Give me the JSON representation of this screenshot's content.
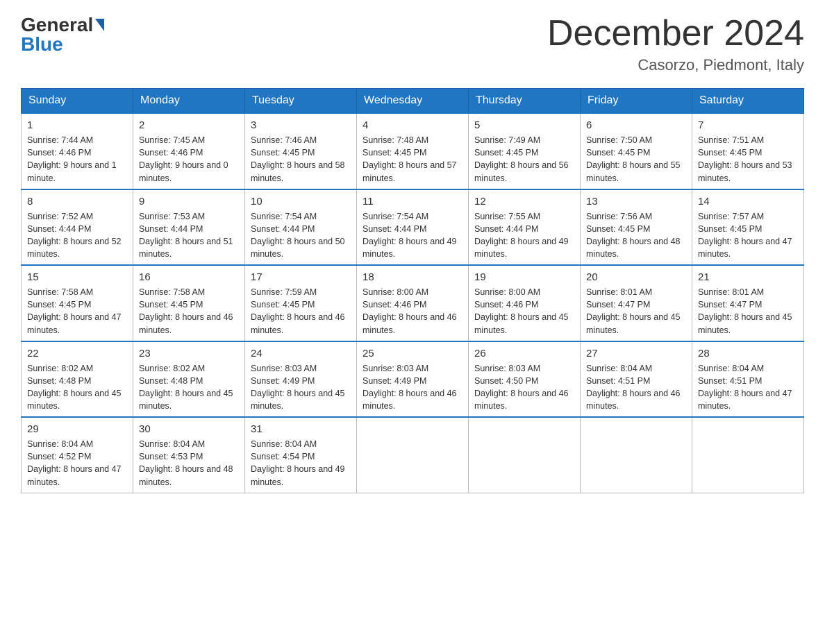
{
  "header": {
    "logo_general": "General",
    "logo_blue": "Blue",
    "month_title": "December 2024",
    "location": "Casorzo, Piedmont, Italy"
  },
  "days_of_week": [
    "Sunday",
    "Monday",
    "Tuesday",
    "Wednesday",
    "Thursday",
    "Friday",
    "Saturday"
  ],
  "weeks": [
    [
      {
        "day": "1",
        "sunrise": "7:44 AM",
        "sunset": "4:46 PM",
        "daylight": "9 hours and 1 minute."
      },
      {
        "day": "2",
        "sunrise": "7:45 AM",
        "sunset": "4:46 PM",
        "daylight": "9 hours and 0 minutes."
      },
      {
        "day": "3",
        "sunrise": "7:46 AM",
        "sunset": "4:45 PM",
        "daylight": "8 hours and 58 minutes."
      },
      {
        "day": "4",
        "sunrise": "7:48 AM",
        "sunset": "4:45 PM",
        "daylight": "8 hours and 57 minutes."
      },
      {
        "day": "5",
        "sunrise": "7:49 AM",
        "sunset": "4:45 PM",
        "daylight": "8 hours and 56 minutes."
      },
      {
        "day": "6",
        "sunrise": "7:50 AM",
        "sunset": "4:45 PM",
        "daylight": "8 hours and 55 minutes."
      },
      {
        "day": "7",
        "sunrise": "7:51 AM",
        "sunset": "4:45 PM",
        "daylight": "8 hours and 53 minutes."
      }
    ],
    [
      {
        "day": "8",
        "sunrise": "7:52 AM",
        "sunset": "4:44 PM",
        "daylight": "8 hours and 52 minutes."
      },
      {
        "day": "9",
        "sunrise": "7:53 AM",
        "sunset": "4:44 PM",
        "daylight": "8 hours and 51 minutes."
      },
      {
        "day": "10",
        "sunrise": "7:54 AM",
        "sunset": "4:44 PM",
        "daylight": "8 hours and 50 minutes."
      },
      {
        "day": "11",
        "sunrise": "7:54 AM",
        "sunset": "4:44 PM",
        "daylight": "8 hours and 49 minutes."
      },
      {
        "day": "12",
        "sunrise": "7:55 AM",
        "sunset": "4:44 PM",
        "daylight": "8 hours and 49 minutes."
      },
      {
        "day": "13",
        "sunrise": "7:56 AM",
        "sunset": "4:45 PM",
        "daylight": "8 hours and 48 minutes."
      },
      {
        "day": "14",
        "sunrise": "7:57 AM",
        "sunset": "4:45 PM",
        "daylight": "8 hours and 47 minutes."
      }
    ],
    [
      {
        "day": "15",
        "sunrise": "7:58 AM",
        "sunset": "4:45 PM",
        "daylight": "8 hours and 47 minutes."
      },
      {
        "day": "16",
        "sunrise": "7:58 AM",
        "sunset": "4:45 PM",
        "daylight": "8 hours and 46 minutes."
      },
      {
        "day": "17",
        "sunrise": "7:59 AM",
        "sunset": "4:45 PM",
        "daylight": "8 hours and 46 minutes."
      },
      {
        "day": "18",
        "sunrise": "8:00 AM",
        "sunset": "4:46 PM",
        "daylight": "8 hours and 46 minutes."
      },
      {
        "day": "19",
        "sunrise": "8:00 AM",
        "sunset": "4:46 PM",
        "daylight": "8 hours and 45 minutes."
      },
      {
        "day": "20",
        "sunrise": "8:01 AM",
        "sunset": "4:47 PM",
        "daylight": "8 hours and 45 minutes."
      },
      {
        "day": "21",
        "sunrise": "8:01 AM",
        "sunset": "4:47 PM",
        "daylight": "8 hours and 45 minutes."
      }
    ],
    [
      {
        "day": "22",
        "sunrise": "8:02 AM",
        "sunset": "4:48 PM",
        "daylight": "8 hours and 45 minutes."
      },
      {
        "day": "23",
        "sunrise": "8:02 AM",
        "sunset": "4:48 PM",
        "daylight": "8 hours and 45 minutes."
      },
      {
        "day": "24",
        "sunrise": "8:03 AM",
        "sunset": "4:49 PM",
        "daylight": "8 hours and 45 minutes."
      },
      {
        "day": "25",
        "sunrise": "8:03 AM",
        "sunset": "4:49 PM",
        "daylight": "8 hours and 46 minutes."
      },
      {
        "day": "26",
        "sunrise": "8:03 AM",
        "sunset": "4:50 PM",
        "daylight": "8 hours and 46 minutes."
      },
      {
        "day": "27",
        "sunrise": "8:04 AM",
        "sunset": "4:51 PM",
        "daylight": "8 hours and 46 minutes."
      },
      {
        "day": "28",
        "sunrise": "8:04 AM",
        "sunset": "4:51 PM",
        "daylight": "8 hours and 47 minutes."
      }
    ],
    [
      {
        "day": "29",
        "sunrise": "8:04 AM",
        "sunset": "4:52 PM",
        "daylight": "8 hours and 47 minutes."
      },
      {
        "day": "30",
        "sunrise": "8:04 AM",
        "sunset": "4:53 PM",
        "daylight": "8 hours and 48 minutes."
      },
      {
        "day": "31",
        "sunrise": "8:04 AM",
        "sunset": "4:54 PM",
        "daylight": "8 hours and 49 minutes."
      },
      null,
      null,
      null,
      null
    ]
  ]
}
